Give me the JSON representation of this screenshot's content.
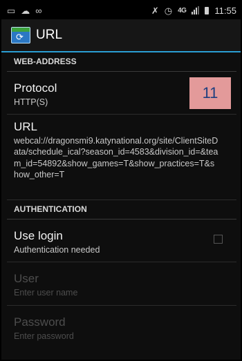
{
  "status_bar": {
    "time": "11:55",
    "network": "4G",
    "icons": [
      "screenshot-icon",
      "cloud-upload-icon",
      "voicemail-icon",
      "bluetooth-off-icon",
      "alarm-icon",
      "signal-icon",
      "battery-icon"
    ]
  },
  "action_bar": {
    "title": "URL",
    "app_icon": "calendar-sync-icon"
  },
  "sections": {
    "web_address": "WEB-ADDRESS",
    "authentication": "AUTHENTICATION"
  },
  "protocol": {
    "title": "Protocol",
    "summary": "HTTP(S)"
  },
  "annotation_badge": "11",
  "url": {
    "title": "URL",
    "summary": "webcal://dragonsmi9.katynational.org/site/ClientSiteData/schedule_ical?season_id=4583&division_id=&team_id=54892&show_games=T&show_practices=T&show_other=T"
  },
  "use_login": {
    "title": "Use login",
    "summary": "Authentication needed",
    "checked": false
  },
  "user": {
    "title": "User",
    "summary": "Enter user name"
  },
  "password": {
    "title": "Password",
    "summary": "Enter password"
  },
  "colors": {
    "accent": "#2a9fd4",
    "badge_bg": "#e39a9a",
    "badge_text": "#1f3f7f"
  }
}
